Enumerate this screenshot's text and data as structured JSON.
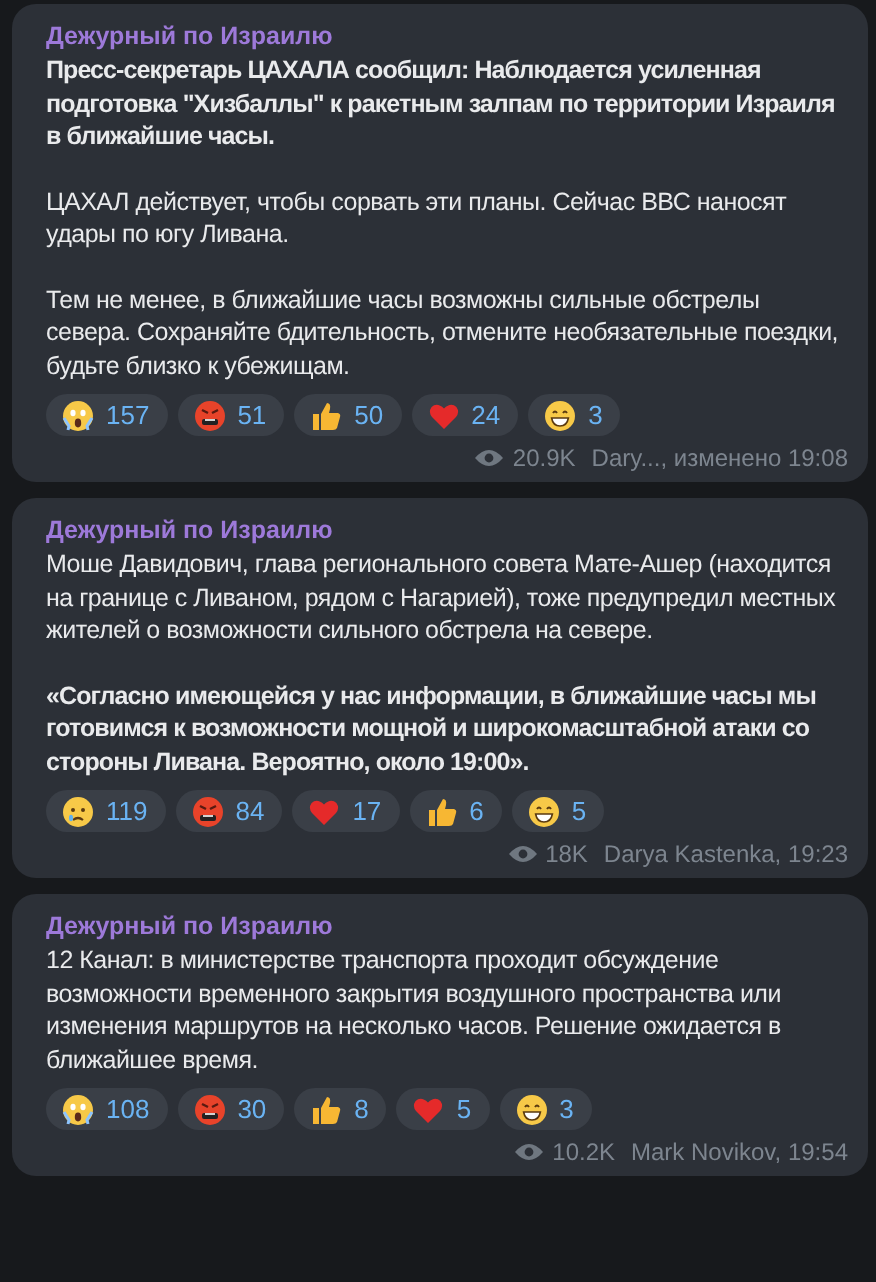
{
  "messages": [
    {
      "sender": "Дежурный по Израилю",
      "paragraphs": [
        {
          "text": "Пресс-секретарь ЦАХАЛА сообщил: Наблюдается усиленная подготовка \"Хизбаллы\" к ракетным залпам по территории Израиля в ближайшие часы.",
          "bold": true
        },
        {
          "text": "ЦАХАЛ действует, чтобы сорвать эти планы. Сейчас ВВС наносят удары по югу Ливана.",
          "bold": false
        },
        {
          "text": "Тем не менее, в ближайшие часы возможны сильные обстрелы севера. Сохраняйте бдительность, отмените необязательные поездки, будьте близко к убежищам.",
          "bold": false
        }
      ],
      "reactions": [
        {
          "kind": "scream",
          "count": "157"
        },
        {
          "kind": "angry",
          "count": "51"
        },
        {
          "kind": "thumbs",
          "count": "50"
        },
        {
          "kind": "heart",
          "count": "24"
        },
        {
          "kind": "grin",
          "count": "3"
        }
      ],
      "views": "20.9K",
      "signature": "Dary..., изменено 19:08"
    },
    {
      "sender": "Дежурный по Израилю",
      "paragraphs": [
        {
          "text": "Моше Давидович, глава регионального совета Мате-Ашер (находится на границе с Ливаном, рядом с Нагарией), тоже предупредил местных жителей о возможности сильного обстрела на севере.",
          "bold": false
        },
        {
          "text": "«Согласно имеющейся у нас информации, в ближайшие часы мы готовимся к возможности мощной и широкомасштабной атаки со стороны Ливана. Вероятно, около 19:00».",
          "bold": true
        }
      ],
      "reactions": [
        {
          "kind": "cry",
          "count": "119"
        },
        {
          "kind": "angry",
          "count": "84"
        },
        {
          "kind": "heart",
          "count": "17"
        },
        {
          "kind": "thumbs",
          "count": "6"
        },
        {
          "kind": "grin",
          "count": "5"
        }
      ],
      "views": "18K",
      "signature": "Darya Kastenka, 19:23"
    },
    {
      "sender": "Дежурный по Израилю",
      "paragraphs": [
        {
          "text": "12 Канал: в министерстве транспорта проходит обсуждение возможности временного закрытия воздушного пространства или изменения маршрутов на несколько часов. Решение ожидается в ближайшее время.",
          "bold": false
        }
      ],
      "reactions": [
        {
          "kind": "scream",
          "count": "108"
        },
        {
          "kind": "angry",
          "count": "30"
        },
        {
          "kind": "thumbs",
          "count": "8"
        },
        {
          "kind": "heart",
          "count": "5"
        },
        {
          "kind": "grin",
          "count": "3"
        }
      ],
      "views": "10.2K",
      "signature": "Mark Novikov, 19:54"
    }
  ]
}
